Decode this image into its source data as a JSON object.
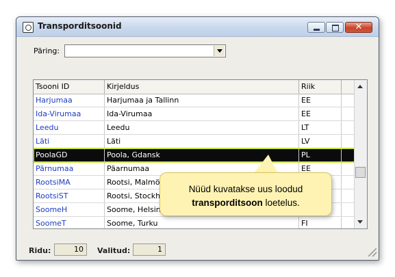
{
  "window": {
    "title": "Transporditsoonid",
    "buttons": {
      "minimize": "–",
      "maximize": "□",
      "close": "✕"
    }
  },
  "query": {
    "label": "Päring:",
    "value": ""
  },
  "grid": {
    "columns": [
      "Tsooni ID",
      "Kirjeldus",
      "Riik"
    ],
    "rows": [
      {
        "id": "Harjumaa",
        "desc": "Harjumaa ja Tallinn",
        "country": "EE"
      },
      {
        "id": "Ida-Virumaa",
        "desc": "Ida-Virumaa",
        "country": "EE"
      },
      {
        "id": "Leedu",
        "desc": "Leedu",
        "country": "LT"
      },
      {
        "id": "Läti",
        "desc": "Läti",
        "country": "LV"
      },
      {
        "id": "PoolaGD",
        "desc": "Poola, Gdansk",
        "country": "PL"
      },
      {
        "id": "Pärnumaa",
        "desc": "Päarnumaa",
        "country": "EE"
      },
      {
        "id": "RootsiMA",
        "desc": "Rootsi, Malmö",
        "country": ""
      },
      {
        "id": "RootsiST",
        "desc": "Rootsi, Stockholm",
        "country": ""
      },
      {
        "id": "SoomeH",
        "desc": "Soome, Helsinki",
        "country": ""
      },
      {
        "id": "SoomeT",
        "desc": "Soome, Turku",
        "country": "FI"
      }
    ]
  },
  "callout": {
    "line1": "Nüüd kuvatakse uus loodud",
    "bold": "transporditsoon",
    "rest": "loetelus."
  },
  "status": {
    "rows_label": "Ridu:",
    "rows_value": "10",
    "selected_label": "Valitud:",
    "selected_value": "1"
  }
}
